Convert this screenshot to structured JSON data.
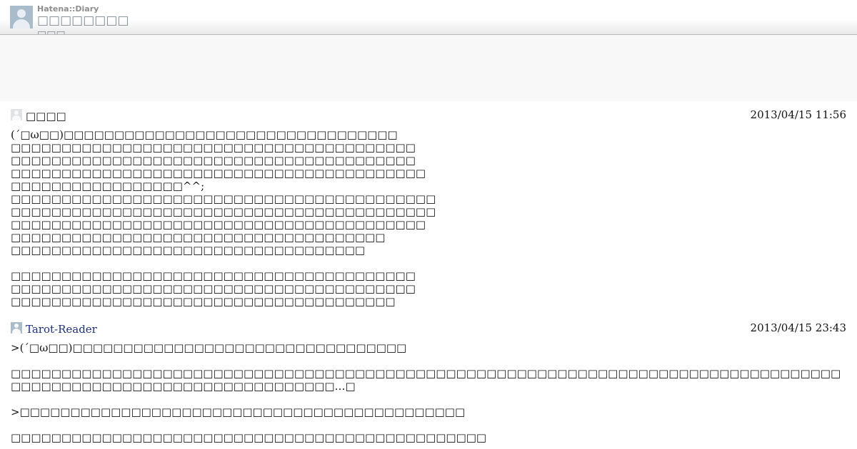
{
  "header": {
    "service_name": "Hatena::Diary",
    "blog_title": "□□□□□□□□",
    "blog_subtitle": "□□□"
  },
  "comments": [
    {
      "author": "□□□□",
      "date": "2013/04/15 11:56",
      "body": "(´□ω□□)□□□□□□□□□□□□□□□□□□□□□□□□□□□□□□□□□\n□□□□□□□□□□□□□□□□□□□□□□□□□□□□□□□□□□□□□□□□\n□□□□□□□□□□□□□□□□□□□□□□□□□□□□□□□□□□□□□□□□\n□□□□□□□□□□□□□□□□□□□□□□□□□□□□□□□□□□□□□□□□□\n□□□□□□□□□□□□□□□□□^^;\n□□□□□□□□□□□□□□□□□□□□□□□□□□□□□□□□□□□□□□□□□□\n□□□□□□□□□□□□□□□□□□□□□□□□□□□□□□□□□□□□□□□□□□\n□□□□□□□□□□□□□□□□□□□□□□□□□□□□□□□□□□□□□□□□□\n□□□□□□□□□□□□□□□□□□□□□□□□□□□□□□□□□□□□□\n□□□□□□□□□□□□□□□□□□□□□□□□□□□□□□□□□□□\n\n□□□□□□□□□□□□□□□□□□□□□□□□□□□□□□□□□□□□□□□□\n□□□□□□□□□□□□□□□□□□□□□□□□□□□□□□□□□□□□□□□□\n□□□□□□□□□□□□□□□□□□□□□□□□□□□□□□□□□□□□□□"
    },
    {
      "author": "Tarot-Reader",
      "date": "2013/04/15 23:43",
      "body": ">(´□ω□□)□□□□□□□□□□□□□□□□□□□□□□□□□□□□□□□□□\n\n□□□□□□□□□□□□□□□□□□□□□□□□□□□□□□□□□□□□□□□□□□□□□□□□□□□□□□□□□□□□□□□□□□□□□□□□□□□□□□□□□□\n□□□□□□□□□□□□□□□□□□□□□□□□□□□□□□□□…□\n\n>□□□□□□□□□□□□□□□□□□□□□□□□□□□□□□□□□□□□□□□□□□□□\n\n□□□□□□□□□□□□□□□□□□□□□□□□□□□□□□□□□□□□□□□□□□□□□□□"
    }
  ]
}
